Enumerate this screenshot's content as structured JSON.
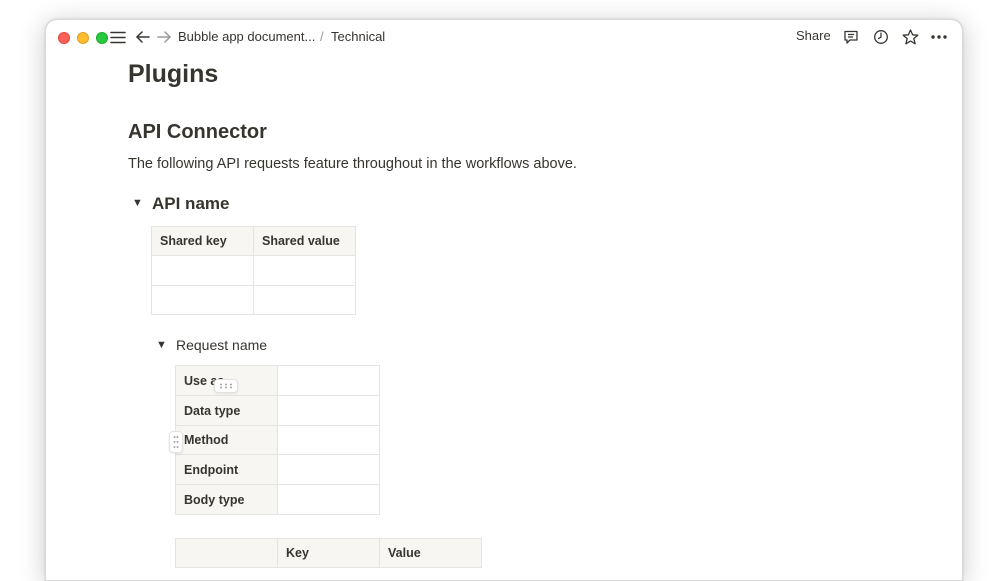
{
  "window": {
    "breadcrumbs": [
      {
        "label": "Bubble app document..."
      },
      {
        "label": "Technical"
      }
    ],
    "breadcrumb_separator": "/",
    "share_label": "Share",
    "icons": [
      "sidebar-toggle-icon",
      "back-arrow-icon",
      "forward-arrow-icon",
      "comment-icon",
      "history-clock-icon",
      "favorite-star-icon",
      "more-options-icon"
    ]
  },
  "page": {
    "title": "Plugins",
    "section_heading": "API Connector",
    "description": "The following API requests feature throughout in the workflows above.",
    "api_toggle": {
      "arrow": "▼",
      "label": "API name",
      "table": {
        "headers": [
          "Shared key",
          "Shared value"
        ],
        "rows": [
          [
            "",
            ""
          ],
          [
            "",
            ""
          ]
        ]
      }
    },
    "request_toggle": {
      "arrow": "▼",
      "label": "Request name",
      "fields_table": {
        "rows": [
          {
            "label": "Use as",
            "value": ""
          },
          {
            "label": "Data type",
            "value": ""
          },
          {
            "label": "Method",
            "value": ""
          },
          {
            "label": "Endpoint",
            "value": ""
          },
          {
            "label": "Body type",
            "value": ""
          }
        ]
      },
      "kv_table": {
        "headers": [
          "",
          "Key",
          "Value"
        ]
      }
    }
  },
  "colors": {
    "text": "#37352f",
    "header_bg": "#f7f6f3",
    "border": "#e4e4e2",
    "traffic_red": "#fe5f57",
    "traffic_yellow": "#febc2e",
    "traffic_green": "#28c840"
  }
}
